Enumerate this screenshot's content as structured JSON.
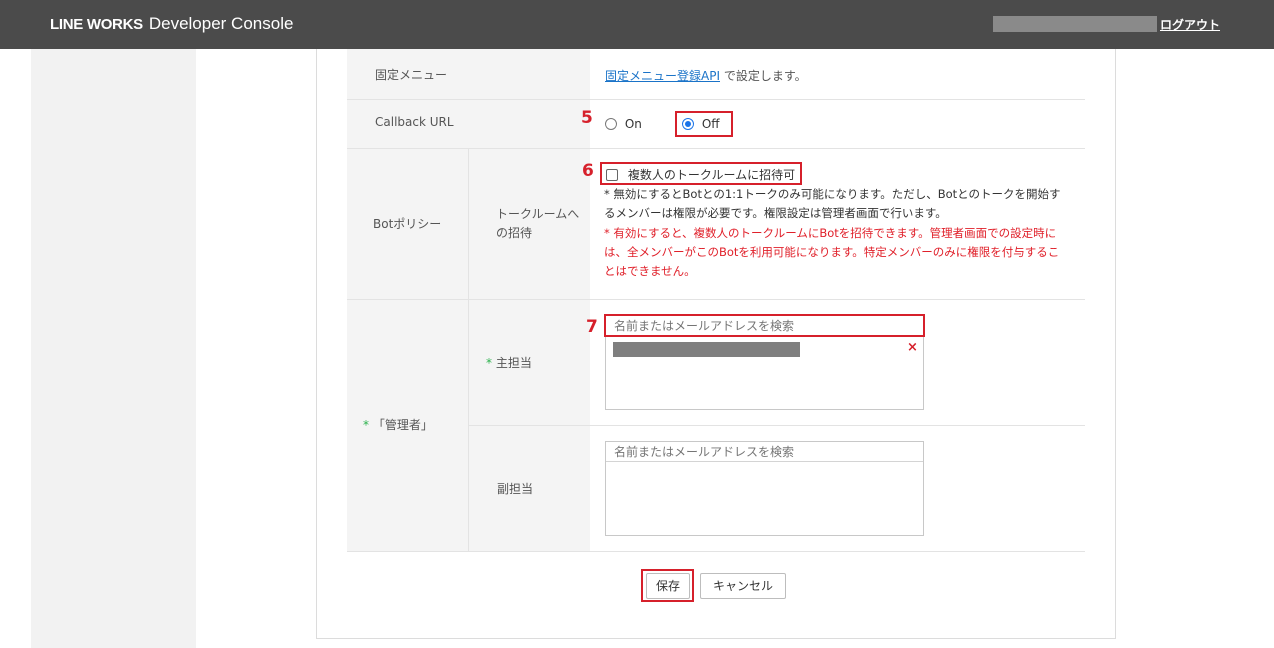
{
  "header": {
    "logo_brand": "LINE WORKS",
    "logo_title": "Developer Console",
    "logout": "ログアウト"
  },
  "rows": {
    "fixed_menu": {
      "label": "固定メニュー",
      "link": "固定メニュー登録API",
      "text": " で設定します。"
    },
    "callback": {
      "label": "Callback URL",
      "marker": "5",
      "option_on": "On",
      "option_off": "Off",
      "selected": "Off"
    },
    "bot_policy": {
      "label": "Botポリシー",
      "sub_label": "トークルームへの招待",
      "marker": "6",
      "checkbox_label": "複数人のトークルームに招待可",
      "checked": false,
      "note1": "* 無効にするとBotとの1:1トークのみ可能になります。ただし、Botとのトークを開始するメンバーは権限が必要です。権限設定は管理者画面で行います。",
      "note2": "* 有効にすると、複数人のトークルームにBotを招待できます。管理者画面での設定時には、全メンバーがこのBotを利用可能になります。特定メンバーのみに権限を付与することはできません。"
    },
    "admin": {
      "required_mark": "*",
      "label": "「管理者」",
      "primary": {
        "required_mark": "*",
        "label": "主担当",
        "marker": "7",
        "placeholder": "名前またはメールアドレスを検索",
        "remove_icon": "×"
      },
      "secondary": {
        "label": "副担当",
        "placeholder": "名前またはメールアドレスを検索"
      }
    }
  },
  "footer": {
    "save": "保存",
    "cancel": "キャンセル"
  },
  "colors": {
    "header_bg": "#4b4b4b",
    "highlight": "#d6202b",
    "link": "#1a73c8",
    "radio_selected": "#1a73e8",
    "required": "#2bb24c",
    "warning_text": "#e0202a"
  }
}
